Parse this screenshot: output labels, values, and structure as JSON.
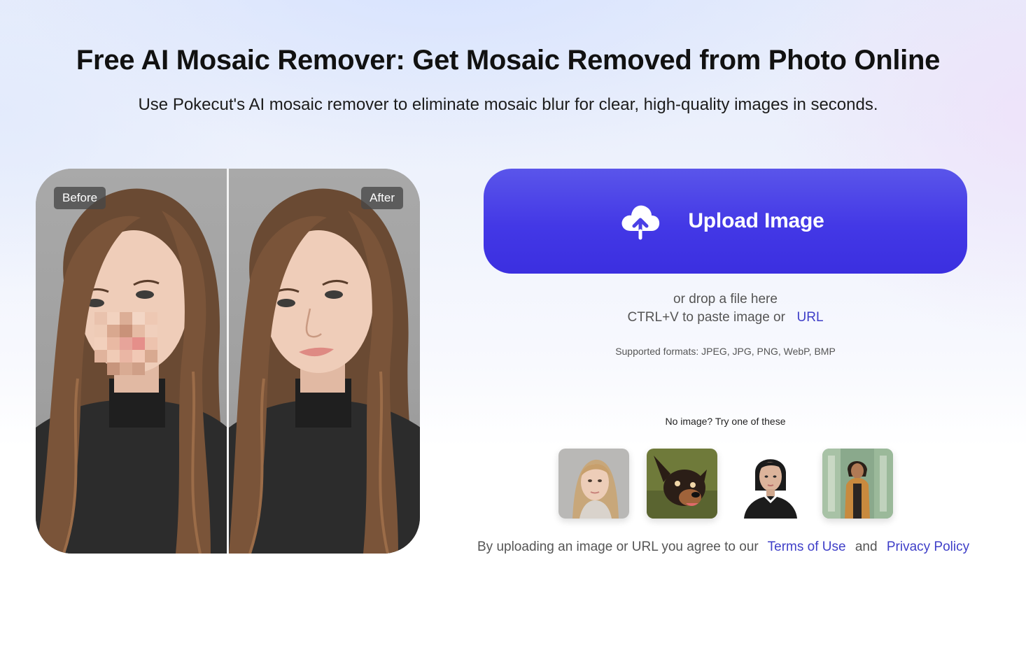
{
  "hero": {
    "title": "Free AI Mosaic Remover: Get Mosaic Removed from Photo Online",
    "subtitle": "Use Pokecut's AI mosaic remover to eliminate mosaic blur for clear, high-quality images in seconds."
  },
  "compare": {
    "before_label": "Before",
    "after_label": "After"
  },
  "upload": {
    "button_label": "Upload Image",
    "icon": "cloud-upload-icon",
    "drop_text": "or drop a file here",
    "paste_text": "CTRL+V to paste image or",
    "url_link": "URL",
    "formats": "Supported formats: JPEG, JPG, PNG, WebP, BMP"
  },
  "samples": {
    "prompt": "No image? Try one of these",
    "items": [
      "sample-woman-blonde",
      "sample-dog",
      "sample-woman-portrait",
      "sample-person-outdoor"
    ]
  },
  "legal": {
    "prefix": "By uploading an image or URL you agree to our",
    "terms": "Terms of Use",
    "and": "and",
    "privacy": "Privacy Policy"
  },
  "colors": {
    "accent": "#4338e6",
    "link": "#3f3fc8"
  }
}
